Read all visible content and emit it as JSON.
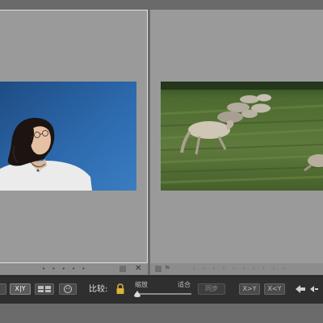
{
  "panes": {
    "left": {
      "dots": "• • • • •",
      "close_glyph": "✕"
    },
    "right": {
      "dots": "• • • • • • • • • •",
      "flag_glyph": "⚑"
    }
  },
  "photos": {
    "left": {
      "subject": "woman-against-blue-sky"
    },
    "right": {
      "subject": "sheep-running-on-grass"
    }
  },
  "toolbar": {
    "view_mode_label": "X|Y",
    "compare_label": "比较:",
    "zoom_label": "缩放",
    "fit_label": "适合",
    "zoom_level": 0,
    "sync_label": "同步",
    "swap_label": "X>Y",
    "swap_back_label": "X<Y",
    "icons": [
      "grid-icon",
      "people-icon",
      "lock-icon",
      "arrow-left-icon",
      "arrow-next-icon"
    ],
    "accent_color": "#d9b43a"
  }
}
